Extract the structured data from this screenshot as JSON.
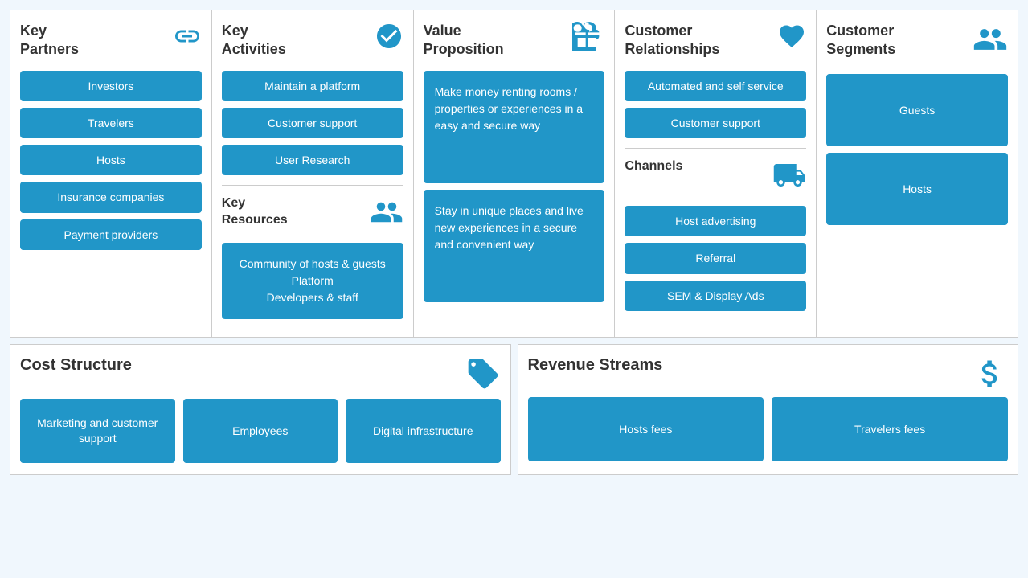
{
  "columns": [
    {
      "id": "key-partners",
      "title": "Key\nPartners",
      "icon": "link",
      "items": [
        "Investors",
        "Travelers",
        "Hosts",
        "Insurance companies",
        "Payment providers"
      ]
    },
    {
      "id": "key-activities",
      "title": "Key\nActivities",
      "icon": "check",
      "activities": [
        "Maintain a platform",
        "Customer support",
        "User Research"
      ],
      "sub_title": "Key\nResources",
      "sub_icon": "people",
      "resources": [
        "Community of hosts &\nguests\nPlatform\nDevelopers & staff"
      ]
    },
    {
      "id": "value-proposition",
      "title": "Value\nProposition",
      "icon": "gift",
      "boxes": [
        "Make money renting rooms / properties or experiences in a easy and secure way",
        "Stay in unique places and live new experiences in a secure and convenient way"
      ]
    },
    {
      "id": "customer-relationships",
      "title": "Customer\nRelationships",
      "icon": "heart",
      "items": [
        "Automated and self service",
        "Customer support"
      ],
      "sub_title": "Channels",
      "sub_icon": "truck",
      "channels": [
        "Host advertising",
        "Referral",
        "SEM & Display Ads"
      ]
    },
    {
      "id": "customer-segments",
      "title": "Customer\nSegments",
      "icon": "people",
      "items": [
        "Guests",
        "Hosts"
      ]
    }
  ],
  "cost_structure": {
    "title": "Cost Structure",
    "icon": "tag",
    "items": [
      "Marketing and customer support",
      "Employees",
      "Digital infrastructure"
    ]
  },
  "revenue_streams": {
    "title": "Revenue Streams",
    "icon": "money",
    "items": [
      "Hosts fees",
      "Travelers fees"
    ]
  }
}
